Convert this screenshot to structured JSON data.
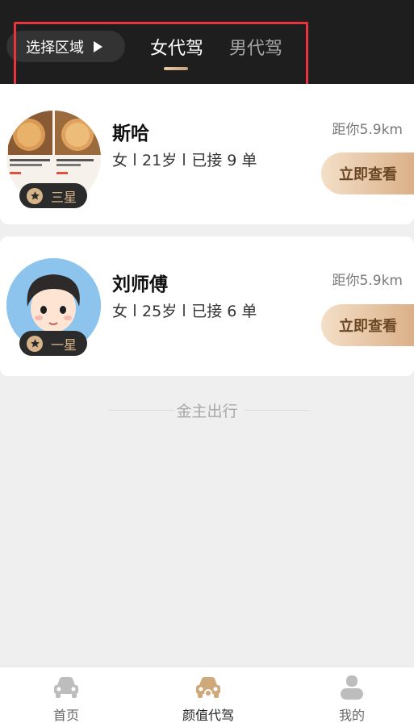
{
  "header": {
    "region_button_label": "选择区域",
    "tabs": [
      {
        "label": "女代驾",
        "active": true
      },
      {
        "label": "男代驾",
        "active": false
      }
    ]
  },
  "drivers": [
    {
      "name": "斯哈",
      "gender": "女",
      "age": "21岁",
      "orders": "已接 9 单",
      "distance": "距你5.9km",
      "rating": "三星",
      "action_label": "立即查看",
      "avatar": "food-photo"
    },
    {
      "name": "刘师傅",
      "gender": "女",
      "age": "25岁",
      "orders": "已接 6 单",
      "distance": "距你5.9km",
      "rating": "一星",
      "action_label": "立即查看",
      "avatar": "cartoon-man"
    }
  ],
  "footer_note": "金主出行",
  "tabbar": {
    "items": [
      {
        "label": "首页",
        "icon": "car-icon",
        "active": false
      },
      {
        "label": "颜值代驾",
        "icon": "car-icon",
        "active": true
      },
      {
        "label": "我的",
        "icon": "user-icon",
        "active": false
      }
    ]
  },
  "colors": {
    "header_bg": "#1e1e1e",
    "accent_gold": "#d8b48a",
    "highlight_red": "#e8343f"
  }
}
